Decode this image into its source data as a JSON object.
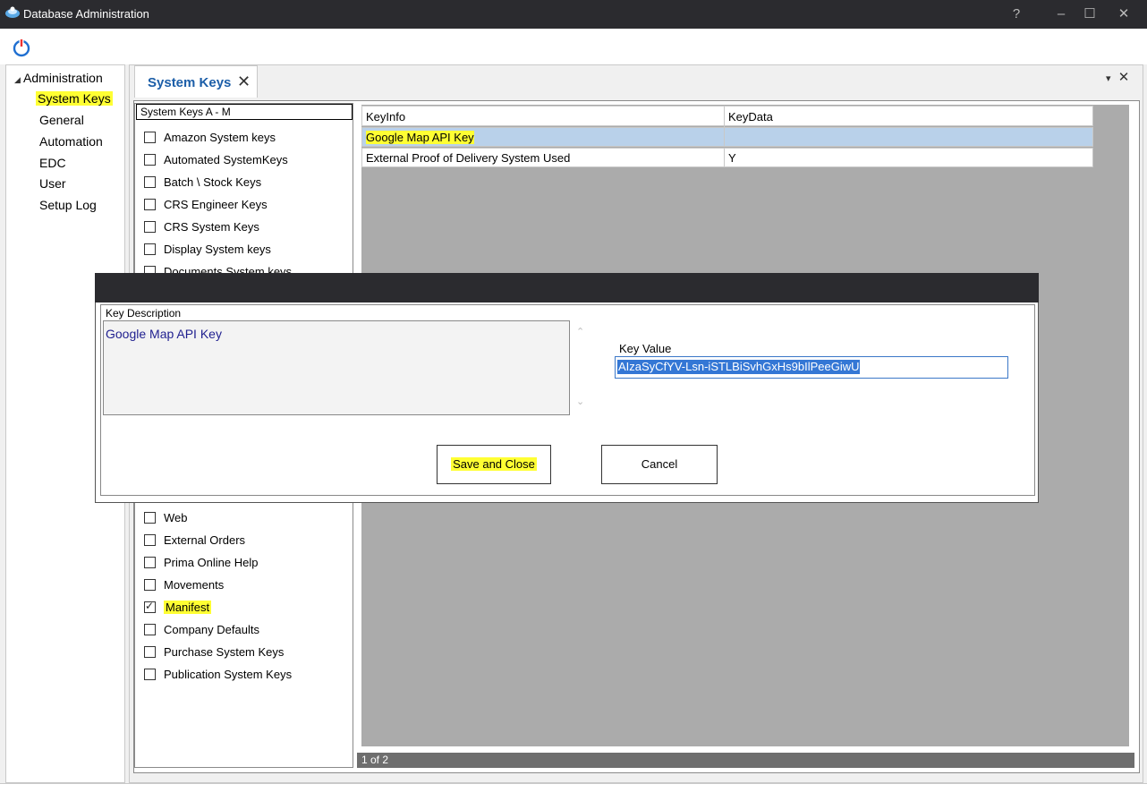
{
  "window": {
    "title": "Database Administration",
    "controls": {
      "help": "?",
      "minimize": "–",
      "maximize": "☐",
      "close": "✕"
    }
  },
  "toolbar": {
    "power_icon": "power-icon"
  },
  "tree": {
    "root": "Administration",
    "root_glyph": "◢",
    "items": [
      {
        "label": "System Keys",
        "selected": true
      },
      {
        "label": "General"
      },
      {
        "label": "Automation"
      },
      {
        "label": "EDC"
      },
      {
        "label": "User"
      },
      {
        "label": "Setup Log"
      }
    ]
  },
  "tab": {
    "label": "System Keys",
    "close": "✕",
    "panel_pin": "▾",
    "panel_close": "✕"
  },
  "checklist": {
    "header": "System Keys A - M",
    "items": [
      {
        "label": "Amazon System keys",
        "checked": false
      },
      {
        "label": "Automated SystemKeys",
        "checked": false
      },
      {
        "label": "Batch \\ Stock Keys",
        "checked": false
      },
      {
        "label": "CRS Engineer Keys",
        "checked": false
      },
      {
        "label": "CRS System Keys",
        "checked": false
      },
      {
        "label": "Display System keys",
        "checked": false
      },
      {
        "label": "Documents System keys",
        "checked": false
      },
      {
        "label": "Web",
        "checked": false
      },
      {
        "label": "External Orders",
        "checked": false
      },
      {
        "label": "Prima Online Help",
        "checked": false
      },
      {
        "label": "Movements",
        "checked": false
      },
      {
        "label": "Manifest",
        "checked": true
      },
      {
        "label": "Company Defaults",
        "checked": false
      },
      {
        "label": "Purchase System Keys",
        "checked": false
      },
      {
        "label": "Publication System Keys",
        "checked": false
      }
    ]
  },
  "grid": {
    "columns": [
      "KeyInfo",
      "KeyData"
    ],
    "rows": [
      [
        "Google Map API Key",
        ""
      ],
      [
        "External Proof of Delivery System Used",
        "Y"
      ]
    ],
    "pager": "1 of 2"
  },
  "dialog": {
    "key_description_label": "Key Description",
    "key_description": "Google Map API Key",
    "key_value_label": "Key Value",
    "key_value": "AIzaSyCfYV-Lsn-iSTLBiSvhGxHs9bIlPeeGiwU",
    "save_label": "Save and Close",
    "cancel_label": "Cancel",
    "scroll_up": "⌃",
    "scroll_down": "⌄"
  },
  "colors": {
    "highlight": "#ffff33",
    "selected_row": "#b9d1ea",
    "accent": "#1c5ea8"
  }
}
